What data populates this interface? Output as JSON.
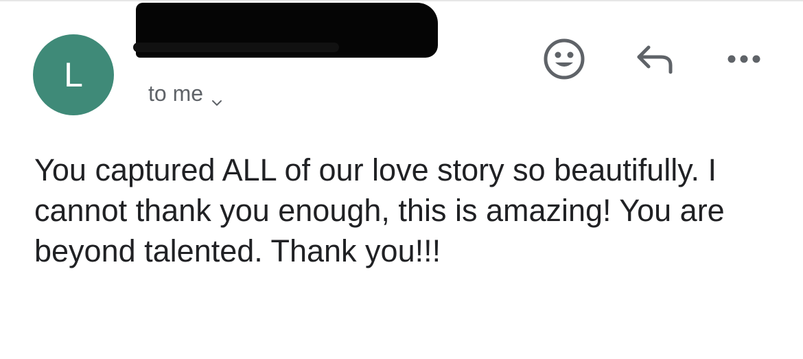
{
  "sender": {
    "avatar_initial": "L",
    "avatar_color": "#3f8a78",
    "name_redacted": true
  },
  "recipient": {
    "label": "to me",
    "expand_icon": "chevron-down-icon"
  },
  "actions": {
    "emoji_icon": "smiley-icon",
    "reply_icon": "reply-icon",
    "more_icon": "more-horizontal-icon"
  },
  "message": {
    "body": "You captured ALL of our love story so beautifully. I cannot thank you enough, this is amazing! You are beyond talented. Thank you!!!"
  },
  "colors": {
    "text": "#202124",
    "secondary_text": "#5f6368",
    "icon": "#5f6368"
  }
}
